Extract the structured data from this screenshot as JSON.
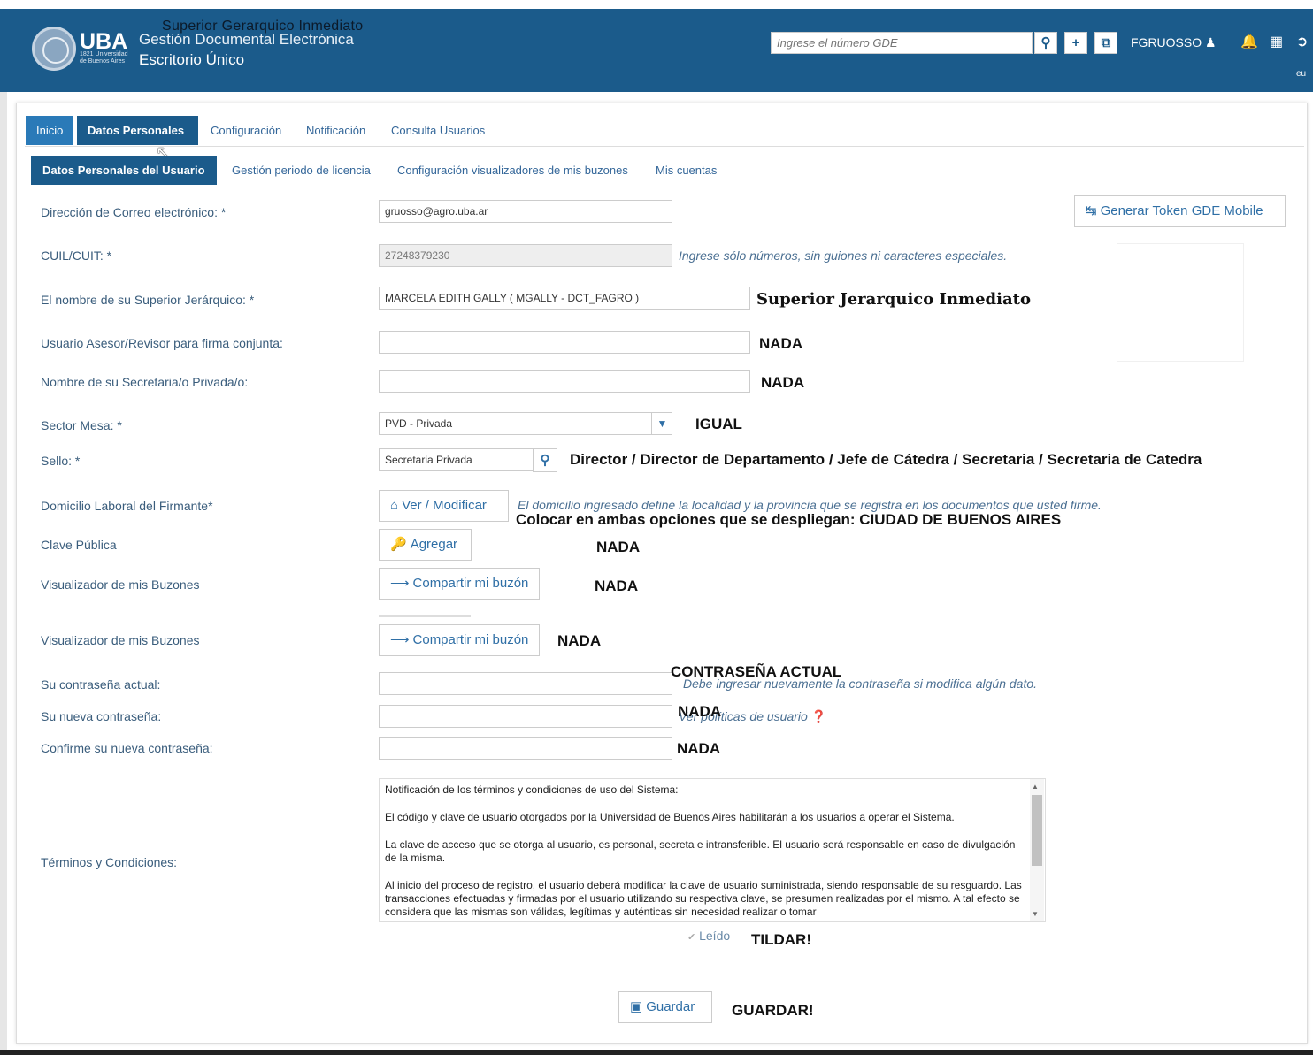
{
  "header": {
    "overlay_title": "Superior Gerarquico Inmediato",
    "logo_text": "UBA",
    "logo_sub": "1821 Universidad de Buenos Aires",
    "app_title": "Gestión Documental Electrónica",
    "app_subtitle": "Escritorio Único",
    "search_placeholder": "Ingrese el número GDE",
    "username": "FGRUOSSO",
    "corner_text": "eu"
  },
  "tabs_main": [
    {
      "label": "Inicio"
    },
    {
      "label": "Datos Personales"
    },
    {
      "label": "Configuración"
    },
    {
      "label": "Notificación"
    },
    {
      "label": "Consulta Usuarios"
    }
  ],
  "tabs_sub": [
    {
      "label": "Datos Personales del Usuario"
    },
    {
      "label": "Gestión periodo de licencia"
    },
    {
      "label": "Configuración visualizadores de mis buzones"
    },
    {
      "label": "Mis cuentas"
    }
  ],
  "form": {
    "email": {
      "label": "Dirección de Correo electrónico: *",
      "value": "gruosso@agro.uba.ar"
    },
    "token_button": "Generar Token GDE Mobile",
    "cuil": {
      "label": "CUIL/CUIT: *",
      "value": "27248379230",
      "hint": "Ingrese sólo números, sin guiones ni caracteres especiales."
    },
    "superior": {
      "label": "El nombre de su Superior Jerárquico: *",
      "value": "MARCELA EDITH GALLY ( MGALLY - DCT_FAGRO )"
    },
    "asesor": {
      "label": "Usuario Asesor/Revisor para firma conjunta:",
      "value": ""
    },
    "secretaria": {
      "label": "Nombre de su Secretaria/o Privada/o:",
      "value": ""
    },
    "sector": {
      "label": "Sector Mesa: *",
      "value": "PVD - Privada"
    },
    "sello": {
      "label": "Sello: *",
      "value": "Secretaria Privada"
    },
    "domicilio": {
      "label": "Domicilio Laboral del Firmante*",
      "button": "Ver / Modificar",
      "hint": "El domicilio ingresado define la localidad y la provincia que se registra en los documentos que usted firme."
    },
    "clave": {
      "label": "Clave Pública",
      "button": "Agregar"
    },
    "visualizador1": {
      "label": "Visualizador de mis Buzones",
      "button": "Compartir mi buzón"
    },
    "visualizador2": {
      "label": "Visualizador de mis Buzones",
      "button": "Compartir mi buzón"
    },
    "pass_actual": {
      "label": "Su contraseña actual:",
      "hint": "Debe ingresar nuevamente la contraseña si modifica algún dato."
    },
    "pass_nueva": {
      "label": "Su nueva contraseña:",
      "hint": "Ver políticas de usuario"
    },
    "pass_confirm": {
      "label": "Confirme su nueva contraseña:"
    },
    "terms": {
      "label": "Términos y Condiciones:",
      "paragraphs": [
        "Notificación de los términos y condiciones de uso del Sistema:",
        "El código y clave de usuario otorgados por la Universidad de Buenos Aires habilitarán a los usuarios a operar el Sistema.",
        "La clave de acceso que se otorga al usuario, es personal, secreta e intransferible. El usuario será responsable en caso de divulgación de la misma.",
        "Al inicio del proceso de registro, el usuario deberá modificar la clave de usuario suministrada, siendo responsable de su resguardo. Las transacciones efectuadas y firmadas por el usuario utilizando su respectiva clave, se presumen realizadas por el mismo. A tal efecto se considera que las mismas son válidas, legítimas y auténticas sin necesidad realizar o tomar"
      ],
      "checkbox_label": "Leído"
    },
    "save_button": "Guardar"
  },
  "annotations": {
    "superior": "Superior Jerarquico Inmediato",
    "asesor": "NADA",
    "secretaria": "NADA",
    "sector": "IGUAL",
    "sello": "Director / Director de Departamento / Jefe de Cátedra / Secretaria / Secretaria de Catedra",
    "domicilio": "Colocar en ambas opciones que se despliegan: CIUDAD DE BUENOS AIRES",
    "clave": "NADA",
    "visualizador1": "NADA",
    "visualizador2": "NADA",
    "pass_actual": "CONTRASEÑA ACTUAL",
    "pass_nueva": "NADA",
    "pass_confirm": "NADA",
    "terms": "TILDAR!",
    "save": "GUARDAR!"
  }
}
